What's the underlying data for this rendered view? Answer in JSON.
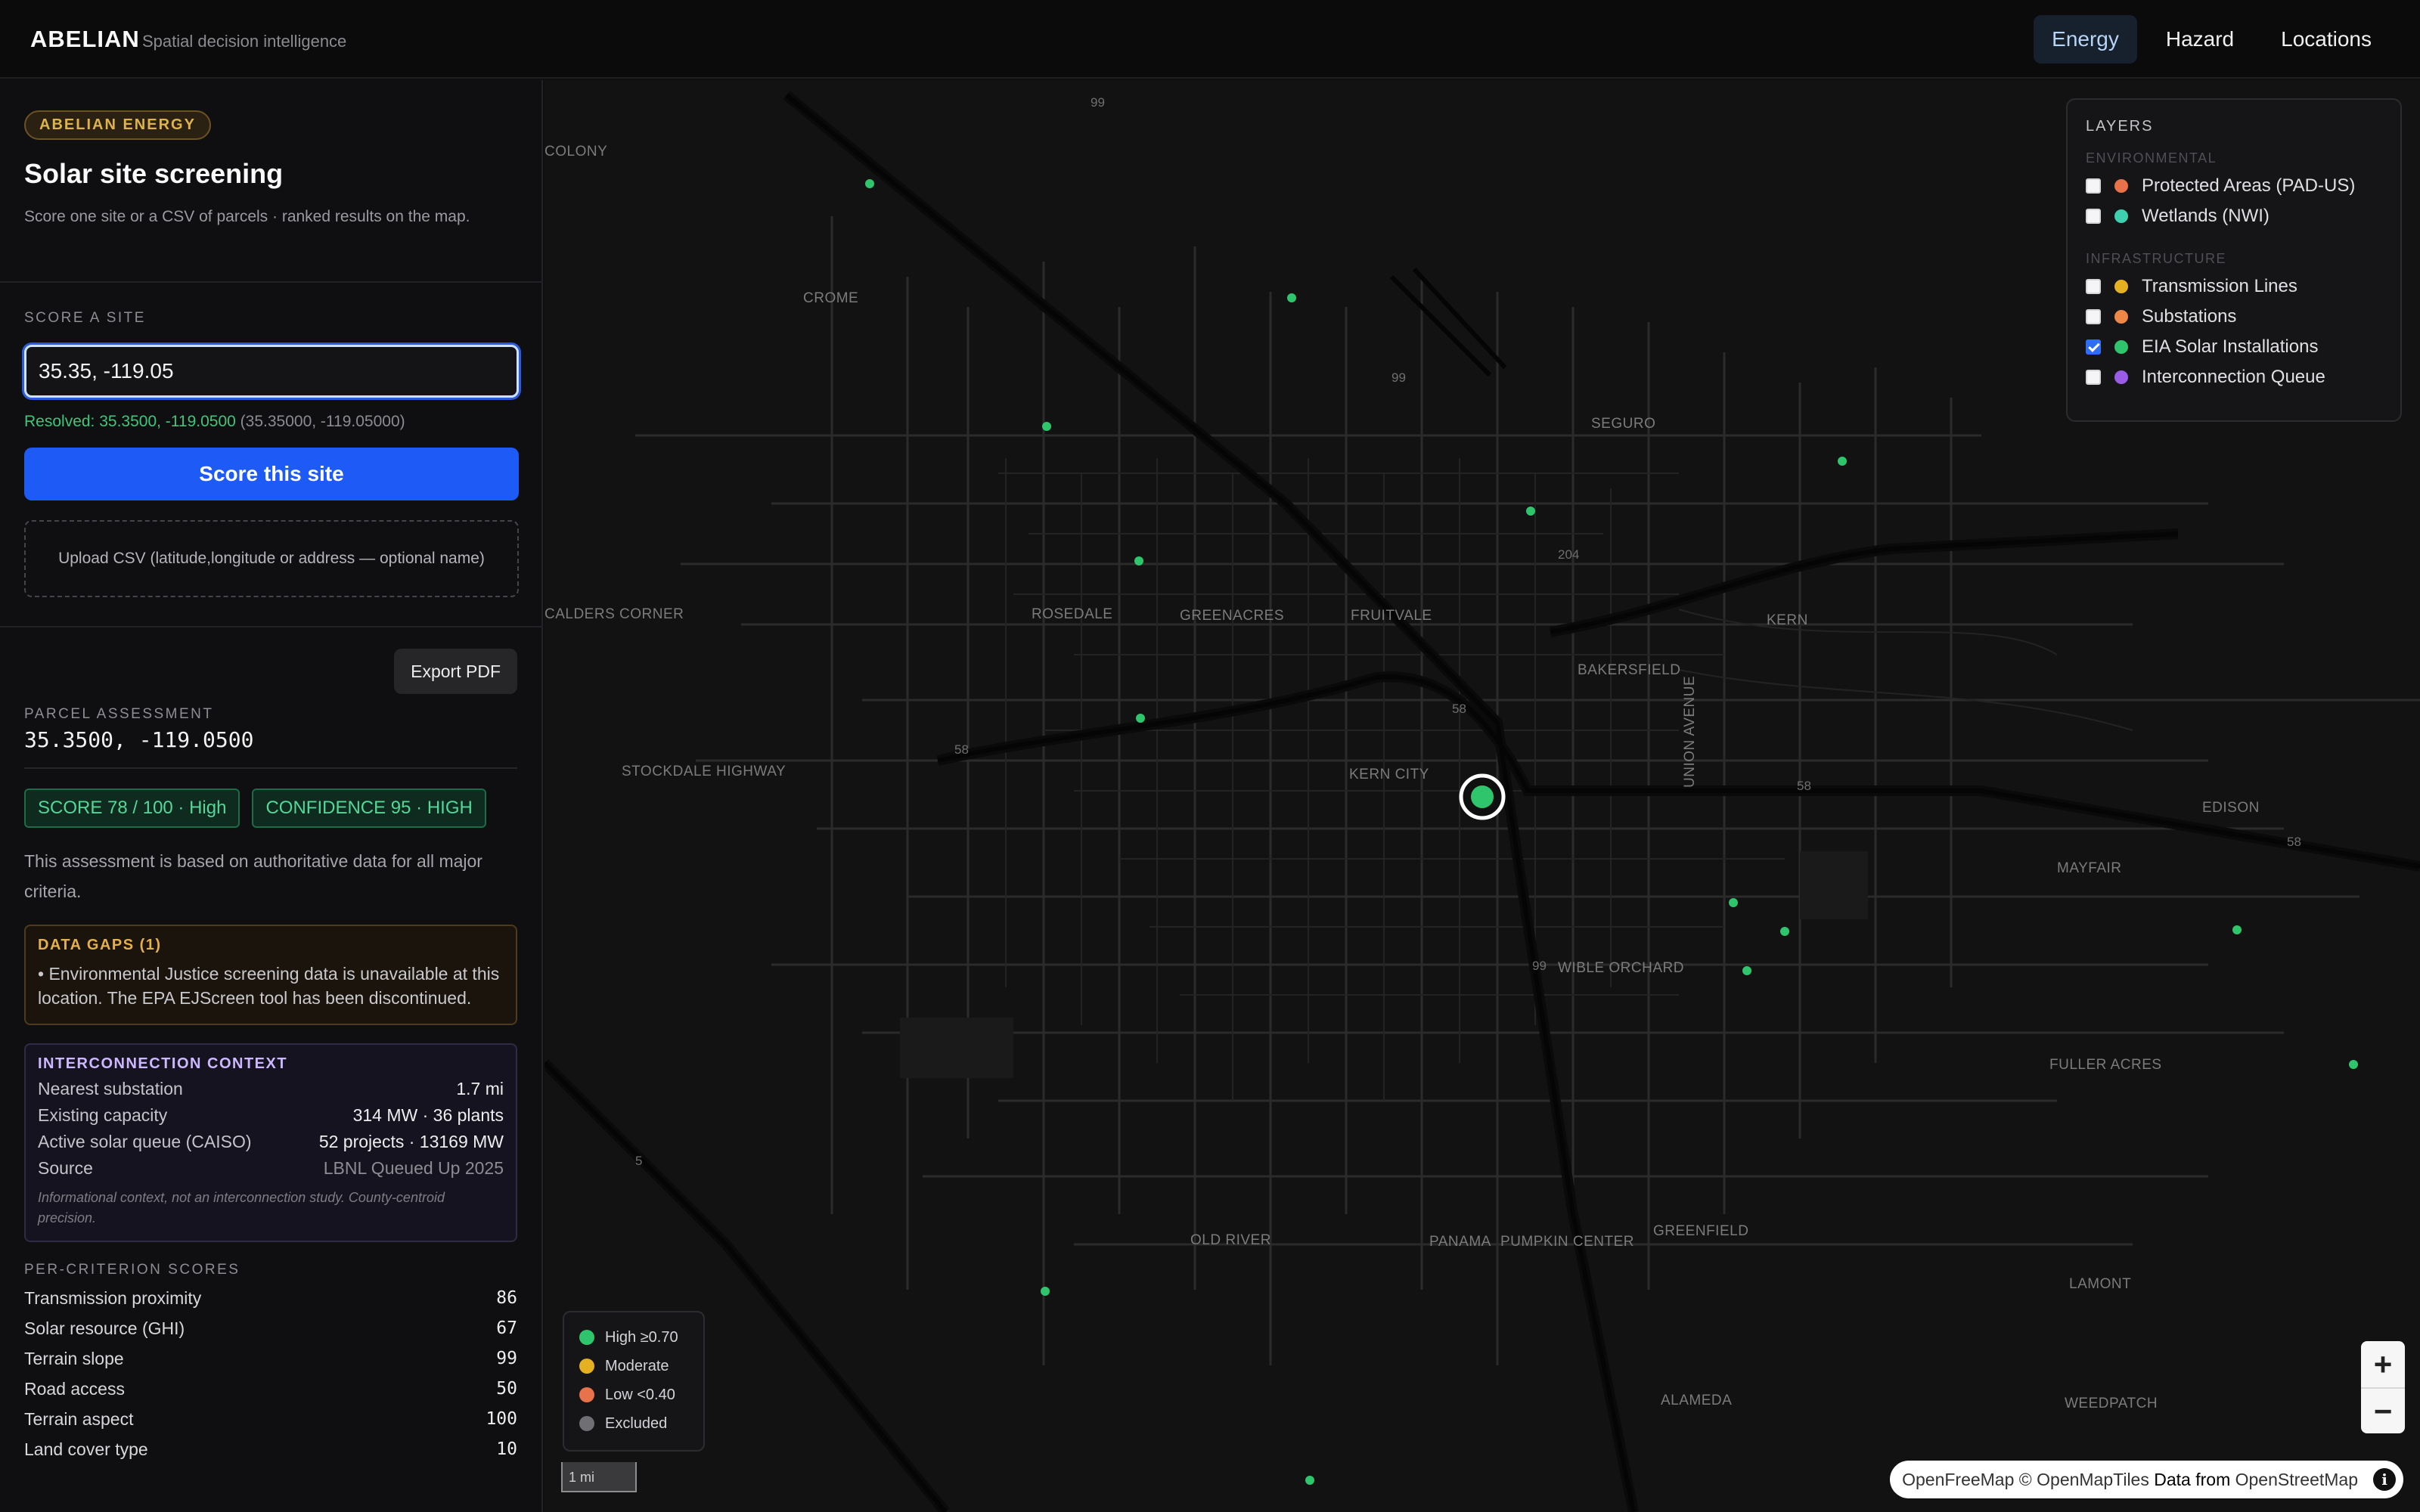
{
  "header": {
    "brand": "ABELIAN",
    "tagline": "Spatial decision intelligence",
    "tabs": [
      {
        "label": "Energy",
        "active": true
      },
      {
        "label": "Hazard",
        "active": false
      },
      {
        "label": "Locations",
        "active": false
      }
    ]
  },
  "sidebar": {
    "badge": "ABELIAN ENERGY",
    "title": "Solar site screening",
    "subtitle": "Score one site or a CSV of parcels · ranked results on the map.",
    "score_section_label": "SCORE A SITE",
    "input_value": "35.35, -119.05",
    "resolved_prefix": "Resolved: 35.3500, -119.0500",
    "resolved_suffix": "(35.35000, -119.05000)",
    "score_button": "Score this site",
    "upload_label": "Upload CSV (latitude,longitude or address — optional name)",
    "export_button": "Export PDF",
    "parcel_label": "PARCEL ASSESSMENT",
    "parcel_coords": "35.3500, -119.0500",
    "score_pill": "SCORE 78 / 100 · High",
    "confidence_pill": "CONFIDENCE 95 · HIGH",
    "assessment_text": "This assessment is based on authoritative data for all major criteria.",
    "data_gaps_title": "DATA GAPS (1)",
    "data_gaps_text": "• Environmental Justice screening data is unavailable at this location. The EPA EJScreen tool has been discontinued.",
    "interconnection": {
      "title": "INTERCONNECTION CONTEXT",
      "rows": [
        {
          "label": "Nearest substation",
          "value": "1.7 mi"
        },
        {
          "label": "Existing capacity",
          "value": "314 MW · 36 plants"
        },
        {
          "label": "Active solar queue (CAISO)",
          "value": "52 projects · 13169 MW"
        },
        {
          "label": "Source",
          "value": "LBNL Queued Up 2025"
        }
      ],
      "note": "Informational context, not an interconnection study. County-centroid precision."
    },
    "criteria_label": "PER-CRITERION SCORES",
    "criteria": [
      {
        "label": "Transmission proximity",
        "value": "86"
      },
      {
        "label": "Solar resource (GHI)",
        "value": "67"
      },
      {
        "label": "Terrain slope",
        "value": "99"
      },
      {
        "label": "Road access",
        "value": "50"
      },
      {
        "label": "Terrain aspect",
        "value": "100"
      },
      {
        "label": "Land cover type",
        "value": "10"
      }
    ]
  },
  "layers": {
    "title": "LAYERS",
    "groups": [
      {
        "name": "ENVIRONMENTAL",
        "items": [
          {
            "label": "Protected Areas (PAD-US)",
            "color": "#e8734a",
            "checked": false
          },
          {
            "label": "Wetlands (NWI)",
            "color": "#3fd0b0",
            "checked": false
          }
        ]
      },
      {
        "name": "INFRASTRUCTURE",
        "items": [
          {
            "label": "Transmission Lines",
            "color": "#e5b123",
            "checked": false
          },
          {
            "label": "Substations",
            "color": "#ee8846",
            "checked": false
          },
          {
            "label": "EIA Solar Installations",
            "color": "#2fc56d",
            "checked": true
          },
          {
            "label": "Interconnection Queue",
            "color": "#9a5ce6",
            "checked": false
          }
        ]
      }
    ]
  },
  "legend": [
    {
      "label": "High ≥0.70",
      "color": "#2fc56d"
    },
    {
      "label": "Moderate",
      "color": "#e5b123"
    },
    {
      "label": "Low <0.40",
      "color": "#e8734a"
    },
    {
      "label": "Excluded",
      "color": "#6f6f74"
    }
  ],
  "map_labels": [
    "COLONY",
    "CROME",
    "SEGURO",
    "ROSEDALE",
    "GREENACRES",
    "FRUITVALE",
    "KERN",
    "BAKERSFIELD",
    "CALDERS CORNER",
    "STOCKDALE HIGHWAY",
    "KERN CITY",
    "UNION AVENUE",
    "EDISON",
    "MAYFAIR",
    "WIBLE ORCHARD",
    "FULLER ACRES",
    "OLD RIVER",
    "PANAMA",
    "PUMPKIN CENTER",
    "GREENFIELD",
    "LAMONT",
    "ALAMEDA",
    "WEEDPATCH"
  ],
  "route_labels": [
    "99",
    "99",
    "204",
    "58",
    "58",
    "58",
    "58",
    "99",
    "5"
  ],
  "scale_label": "1 mi",
  "zoom": {
    "in": "+",
    "out": "−"
  },
  "attribution": {
    "openfreemap": "OpenFreeMap",
    "openmaptiles": "© OpenMapTiles",
    "data_from": "Data from",
    "osm": "OpenStreetMap"
  },
  "info_icon": "i",
  "colors": {
    "accent": "#1e5bf6",
    "high": "#2fc56d"
  }
}
